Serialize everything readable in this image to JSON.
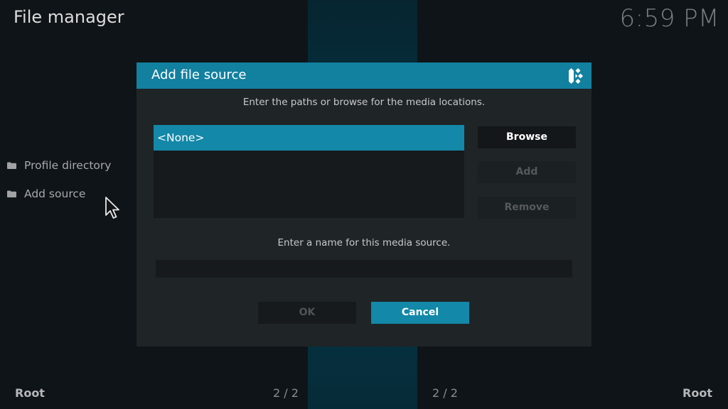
{
  "header": {
    "title": "File manager",
    "clock": "6:59 PM"
  },
  "sidebar": {
    "items": [
      {
        "label": "Profile directory",
        "icon": "folder-icon"
      },
      {
        "label": "Add source",
        "icon": "folder-icon"
      }
    ]
  },
  "footer": {
    "left_label": "Root",
    "right_label": "Root",
    "left_page": "2 / 2",
    "right_page": "2 / 2"
  },
  "dialog": {
    "title": "Add file source",
    "logo_icon": "kodi-logo-icon",
    "paths_hint": "Enter the paths or browse for the media locations.",
    "paths": [
      "<None>"
    ],
    "browse_label": "Browse",
    "add_label": "Add",
    "remove_label": "Remove",
    "name_hint": "Enter a name for this media source.",
    "name_value": "",
    "ok_label": "OK",
    "cancel_label": "Cancel"
  },
  "colors": {
    "accent": "#1388a8",
    "header_bar": "#12809f",
    "dialog_bg": "#1f2427",
    "disabled_text": "#55595c"
  }
}
